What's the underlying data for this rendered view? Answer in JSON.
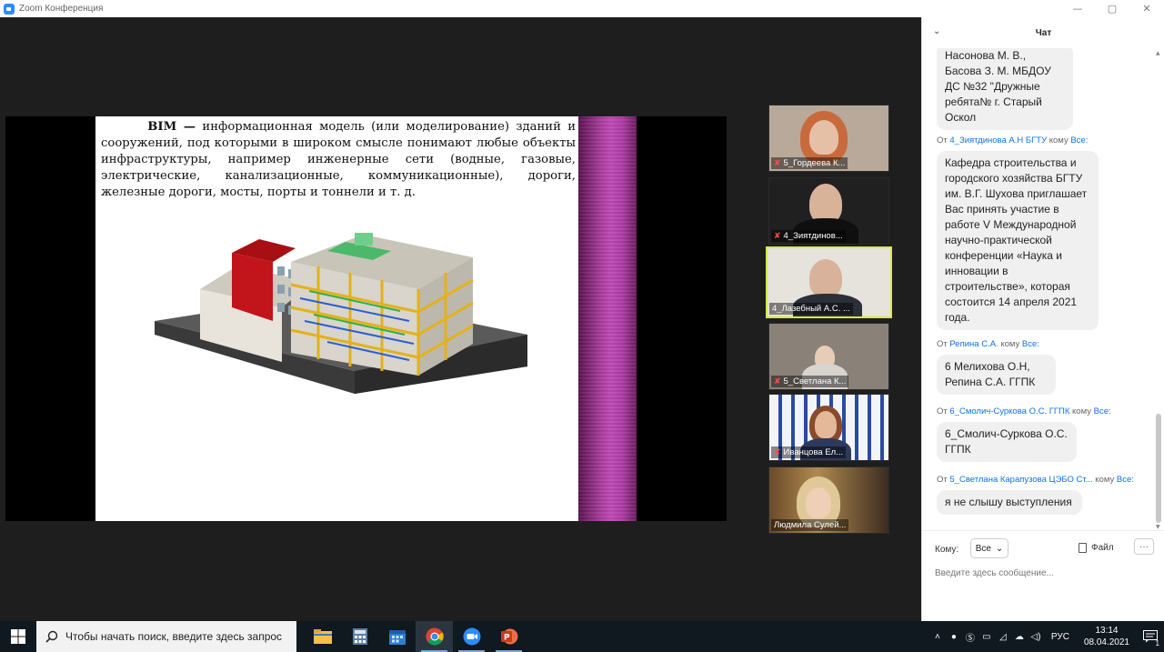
{
  "window": {
    "title": "Zoom Конференция",
    "controls": [
      "—",
      "▢",
      "✕"
    ]
  },
  "slide": {
    "bold_lead": "BIM —",
    "text": " информационная модель (или моделирование) зданий и сооружений, под которыми в широком смысле понимают любые объекты инфраструктуры, например инженерные сети (водные, газовые, электрические, канализационные, коммуникационные), дороги, железные дороги, мосты, порты и тоннели и т. д."
  },
  "participants": [
    {
      "name": "5_Гордеева К...",
      "muted": true
    },
    {
      "name": "4_Зиятдинов...",
      "muted": true
    },
    {
      "name": "4_Лазебный А.С. ...",
      "muted": false,
      "active": true
    },
    {
      "name": "5_Светлана К...",
      "muted": true
    },
    {
      "name": "Иванцова Ел...",
      "muted": true
    },
    {
      "name": "Людмила Сулей...",
      "muted": false
    }
  ],
  "chat": {
    "title": "Чат",
    "messages": [
      {
        "text": "Насонова М. В., Басова З. М. МБДОУ ДС №32 \"Дружные ребята№ г. Старый Оскол"
      },
      {
        "from_prefix": "От",
        "sender": "4_Зиятдинова А.Н БГТУ",
        "to_word": "кому",
        "recipient": "Все:",
        "text": "Кафедра строительства и городского хозяйства БГТУ им. В.Г. Шухова приглашает Вас принять участие в работе V Международной научно-практической конференции «Наука и инновации в строительстве», которая состоится 14 апреля 2021 года."
      },
      {
        "from_prefix": "От",
        "sender": "Репина С.А.",
        "to_word": "кому",
        "recipient": "Все:",
        "text": "6 Мелихова О.Н, Репина С.А. ГГПК"
      },
      {
        "from_prefix": "От",
        "sender": "6_Смолич-Суркова О.С. ГГПК",
        "to_word": "кому",
        "recipient": "Все:",
        "text": "6_Смолич-Суркова О.С. ГГПК"
      },
      {
        "from_prefix": "От",
        "sender": "5_Светлана Карапузова ЦЭБО Ст...",
        "to_word": "кому",
        "recipient": "Все:",
        "text": "я не слышу выступления"
      }
    ],
    "to_label": "Кому:",
    "to_value": "Все",
    "file_label": "Файл",
    "more_label": "···",
    "input_placeholder": "Введите здесь сообщение..."
  },
  "taskbar": {
    "search_placeholder": "Чтобы начать поиск, введите здесь запрос",
    "apps": [
      "file-explorer",
      "calculator",
      "calendar",
      "chrome",
      "zoom",
      "powerpoint"
    ],
    "language": "РУС",
    "time": "13:14",
    "date": "08.04.2021",
    "notification_count": "1"
  },
  "colors": {
    "accent": "#0e72ed",
    "active_speaker": "#d8e84a",
    "muted_mic": "#ff4d4d"
  }
}
